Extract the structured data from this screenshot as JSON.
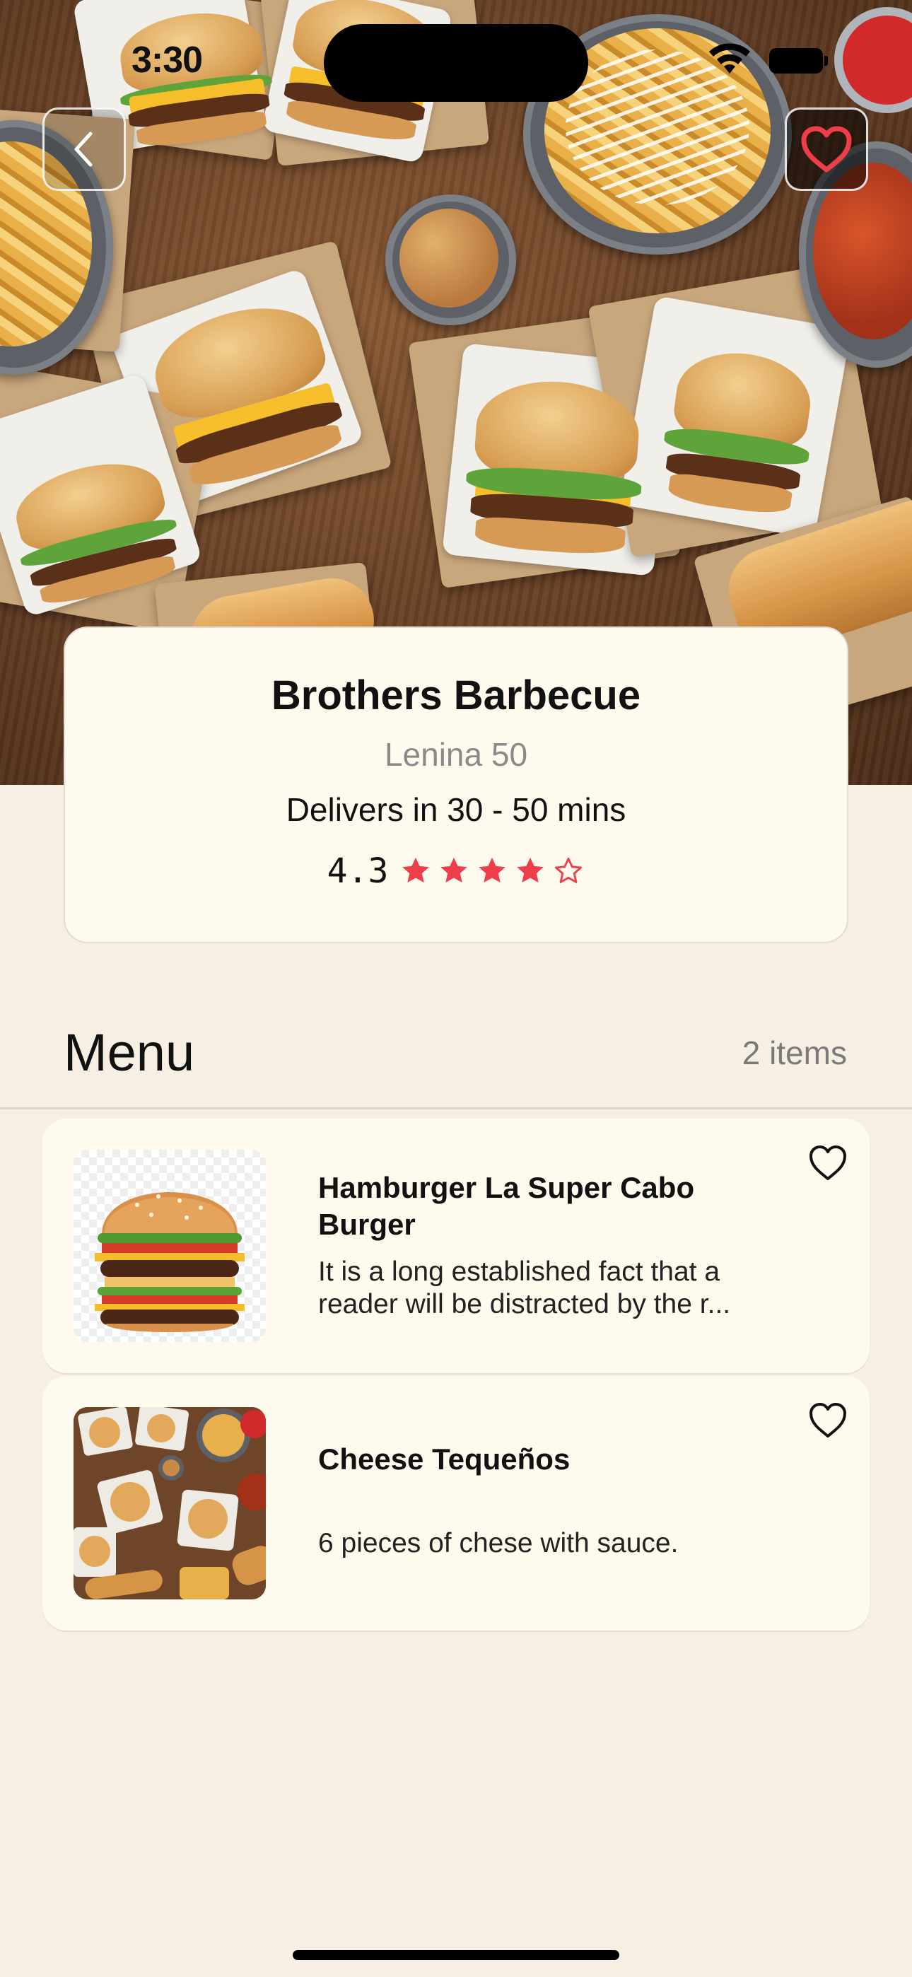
{
  "status_bar": {
    "time": "3:30"
  },
  "restaurant": {
    "name": "Brothers Barbecue",
    "address": "Lenina 50",
    "delivery": "Delivers in 30 - 50 mins",
    "rating": "4.3",
    "rating_stars": 4.3,
    "star_color": "#ef3e4a"
  },
  "menu": {
    "title": "Menu",
    "count_label": "2 items",
    "items": [
      {
        "name": "Hamburger La Super Cabo Burger",
        "description": "It is a long established fact that a reader will be distracted by the r...",
        "image_icon": "burger-image"
      },
      {
        "name": "Cheese Tequeños",
        "description": "6 pieces of chese with sauce.",
        "image_icon": "food-spread-image"
      }
    ]
  },
  "colors": {
    "background": "#f8efe4",
    "card": "#fffaee",
    "accent_red": "#ef3e4a"
  }
}
